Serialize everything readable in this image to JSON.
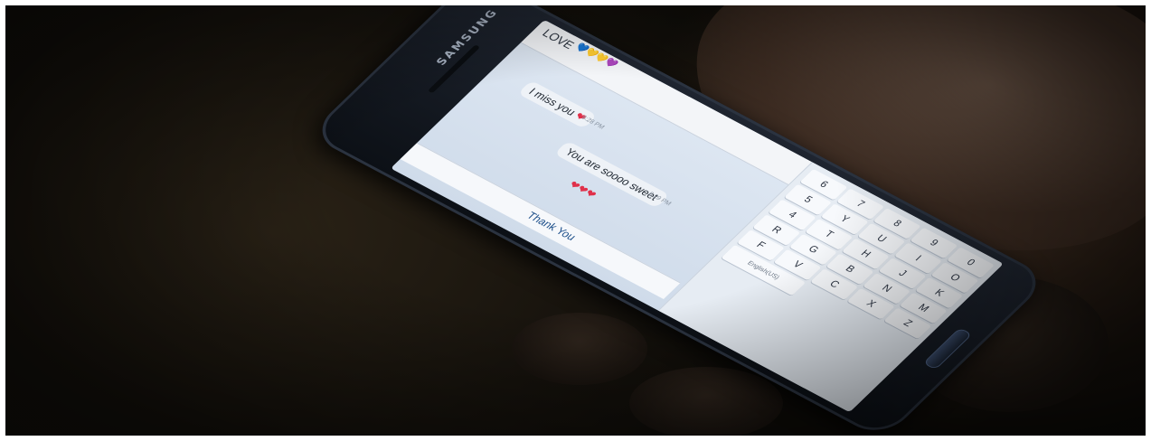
{
  "scene": {
    "phone_brand": "SAMSUNG",
    "colors": {
      "background": "#17130d",
      "screen": "#dfe8f3",
      "phone_body": "#1f2530",
      "skin": "#4a3527",
      "heart": "#e0304a"
    }
  },
  "chat": {
    "contact_name": "LOVE",
    "contact_hearts": [
      "💙",
      "💛",
      "💛",
      "💜"
    ],
    "messages": [
      {
        "text": "I miss you",
        "emoji": "❤",
        "time": "6:28 PM"
      },
      {
        "text": "You are soooo sweet",
        "emoji": "",
        "time": "6:29 PM"
      },
      {
        "text": "",
        "emoji": "❤❤❤",
        "time": ""
      }
    ],
    "suggestion": "Thank You"
  },
  "keyboard": {
    "keys": [
      "6",
      "7",
      "8",
      "9",
      "0",
      "5",
      "Y",
      "U",
      "I",
      "O",
      "4",
      "T",
      "H",
      "J",
      "K",
      "R",
      "G",
      "B",
      "N",
      "M",
      "F",
      "V",
      "C",
      "X",
      "Z"
    ],
    "space_label": "English(US)"
  }
}
